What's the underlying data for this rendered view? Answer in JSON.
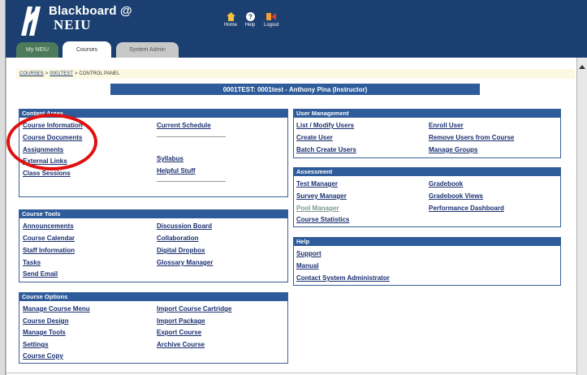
{
  "header": {
    "brand_line1": "Blackboard @",
    "brand_line2": "NEIU",
    "nav": [
      {
        "label": "Home",
        "icon": "home-icon"
      },
      {
        "label": "Help",
        "icon": "help-icon"
      },
      {
        "label": "Logout",
        "icon": "logout-icon"
      }
    ],
    "colors": {
      "banner": "#1a3f70",
      "panel_header": "#2e5b9a",
      "highlight": "#e01010"
    }
  },
  "tabs": [
    {
      "label": "My NEIU",
      "active": false
    },
    {
      "label": "Courses",
      "active": true
    },
    {
      "label": "System Admin",
      "active": false
    }
  ],
  "breadcrumb": {
    "items": [
      "COURSES",
      "0001TEST",
      "CONTROL PANEL"
    ],
    "separator": ">"
  },
  "course_title": "0001TEST: 0001test - Anthony Pina (Instructor)",
  "panels": {
    "content_areas": {
      "title": "Content Areas",
      "left": [
        "Course Information",
        "Course Documents",
        "Assignments",
        "External Links",
        "Class Sessions"
      ],
      "right": [
        "Current Schedule",
        "Syllabus",
        "Helpful Stuff"
      ]
    },
    "course_tools": {
      "title": "Course Tools",
      "left": [
        "Announcements",
        "Course Calendar",
        "Staff Information",
        "Tasks",
        "Send Email"
      ],
      "right": [
        "Discussion Board",
        "Collaboration",
        "Digital Dropbox",
        "Glossary Manager"
      ]
    },
    "course_options": {
      "title": "Course Options",
      "left": [
        "Manage Course Menu",
        "Course Design",
        "Manage Tools",
        "Settings",
        "Course Copy"
      ],
      "right": [
        "Import Course Cartridge",
        "Import Package",
        "Export Course",
        "Archive Course"
      ]
    },
    "user_management": {
      "title": "User Management",
      "left": [
        "List / Modify Users",
        "Create User",
        "Batch Create Users"
      ],
      "right": [
        "Enroll User",
        "Remove Users from Course",
        "Manage Groups"
      ]
    },
    "assessment": {
      "title": "Assessment",
      "left": [
        "Test Manager",
        "Survey Manager",
        "Pool Manager",
        "Course Statistics"
      ],
      "right": [
        "Gradebook",
        "Gradebook Views",
        "Performance Dashboard"
      ]
    },
    "help": {
      "title": "Help",
      "left": [
        "Support",
        "Manual",
        "Contact System Administrator"
      ]
    }
  }
}
